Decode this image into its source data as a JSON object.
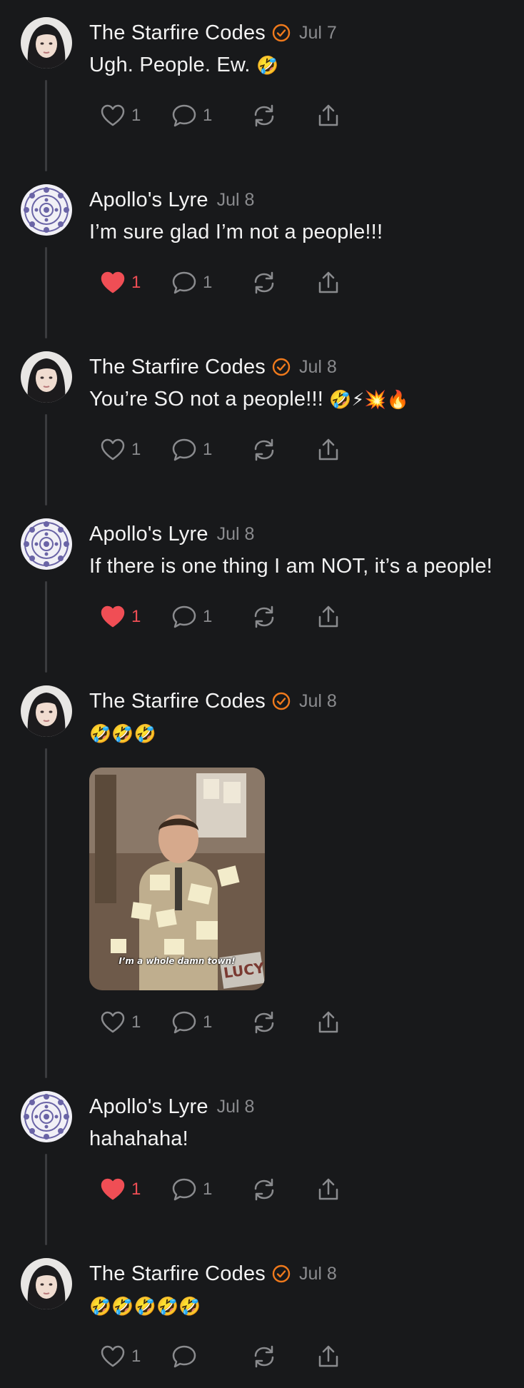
{
  "colors": {
    "background": "#18191b",
    "text": "#f2f2f2",
    "muted": "#8a8b8e",
    "verified": "#f07a1c",
    "liked": "#f04e55",
    "thread_line": "#3a3b3e"
  },
  "posts": [
    {
      "author": "The Starfire Codes",
      "verified": true,
      "avatar": "dark-haired-woman-avatar",
      "date": "Jul 7",
      "text": "Ugh. People. Ew.",
      "emoji": "🤣",
      "liked": false,
      "likes": "1",
      "replies": "1"
    },
    {
      "author": "Apollo's Lyre",
      "verified": false,
      "avatar": "lavender-mandala-avatar",
      "date": "Jul 8",
      "text": "I’m sure glad I’m not a people!!!",
      "emoji": "",
      "liked": true,
      "likes": "1",
      "replies": "1"
    },
    {
      "author": "The Starfire Codes",
      "verified": true,
      "avatar": "dark-haired-woman-avatar",
      "date": "Jul 8",
      "text": "You’re SO not a people!!!",
      "emoji": "🤣⚡💥🔥",
      "liked": false,
      "likes": "1",
      "replies": "1"
    },
    {
      "author": "Apollo's Lyre",
      "verified": false,
      "avatar": "lavender-mandala-avatar",
      "date": "Jul 8",
      "text": "If there is one thing I am NOT, it’s a people!",
      "emoji": "",
      "liked": true,
      "likes": "1",
      "replies": "1"
    },
    {
      "author": "The Starfire Codes",
      "verified": true,
      "avatar": "dark-haired-woman-avatar",
      "date": "Jul 8",
      "text": "",
      "emoji": "🤣🤣🤣",
      "liked": false,
      "likes": "1",
      "replies": "1",
      "media": {
        "type": "gif",
        "description": "officer-covered-in-sticky-notes-gif",
        "caption": "I’m a whole damn town!",
        "sign": "LUCY"
      }
    },
    {
      "author": "Apollo's Lyre",
      "verified": false,
      "avatar": "lavender-mandala-avatar",
      "date": "Jul 8",
      "text": "hahahaha!",
      "emoji": "",
      "liked": true,
      "likes": "1",
      "replies": "1"
    },
    {
      "author": "The Starfire Codes",
      "verified": true,
      "avatar": "dark-haired-woman-avatar",
      "date": "Jul 8",
      "text": "",
      "emoji": "🤣🤣🤣🤣🤣",
      "liked": false,
      "likes": "1",
      "replies": ""
    }
  ]
}
